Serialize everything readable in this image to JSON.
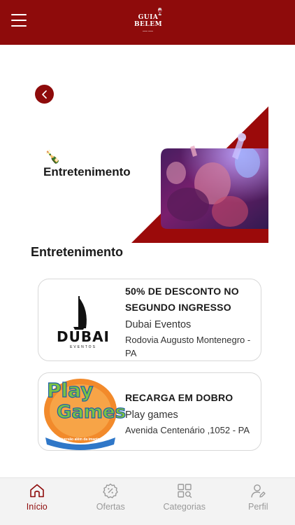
{
  "header": {
    "logo_line1": "GUIA",
    "logo_line2": "BELEM"
  },
  "banner": {
    "title": "Entretenimento"
  },
  "section": {
    "title": "Entretenimento"
  },
  "offers": [
    {
      "title": "50% DE DESCONTO NO SEGUNDO INGRESSO",
      "business": "Dubai Eventos",
      "address": "Rodovia Augusto Montenegro - PA",
      "logo_text": "DUBAI",
      "logo_subtext": "EVENTOS"
    },
    {
      "title": "RECARGA EM DOBRO",
      "business": "Play games",
      "address": "Avenida Centenário ,1052 - PA",
      "logo_text_1": "Play",
      "logo_text_2": "Games",
      "logo_subtext": "Diversão além da imaginação"
    }
  ],
  "nav": {
    "items": [
      {
        "label": "Início",
        "icon": "home-icon",
        "active": true
      },
      {
        "label": "Ofertas",
        "icon": "discount-badge-icon"
      },
      {
        "label": "Categorias",
        "icon": "categories-grid-icon"
      },
      {
        "label": "Perfil",
        "icon": "user-profile-icon"
      }
    ]
  },
  "colors": {
    "brand": "#8e0b0b",
    "nav_inactive": "#9a9a9a"
  }
}
